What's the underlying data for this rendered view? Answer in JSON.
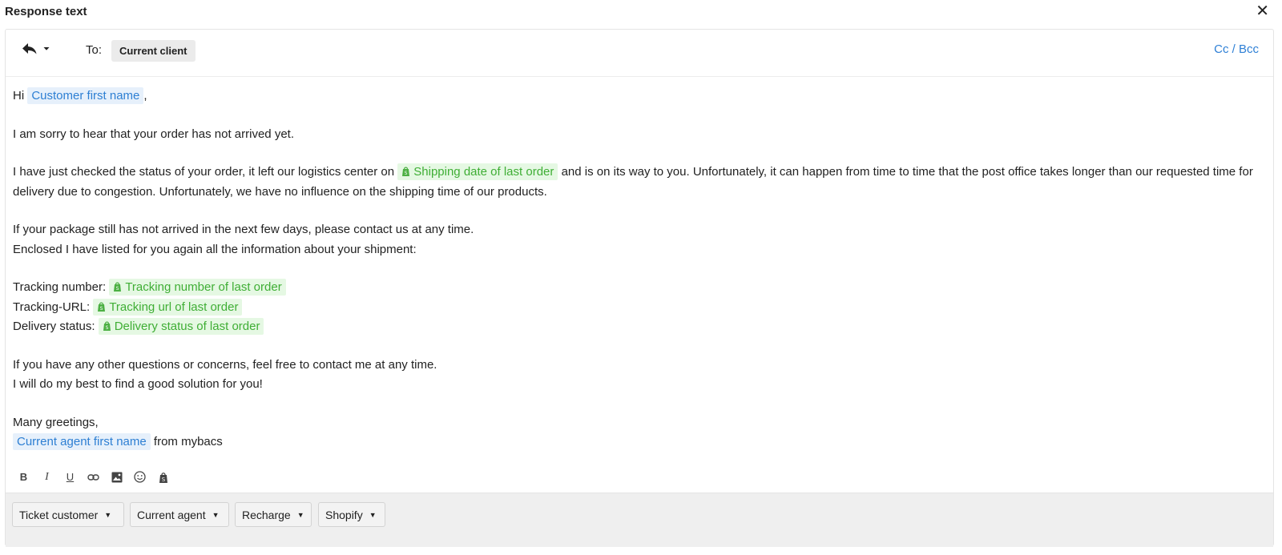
{
  "window": {
    "title": "Response text"
  },
  "header": {
    "to_label": "To:",
    "recipient": "Current client",
    "cc_bcc": "Cc / Bcc"
  },
  "message": {
    "greeting_prefix": "Hi",
    "var_customer_first_name": "Customer first name",
    "greeting_suffix": ",",
    "line1": "I am sorry to hear that your order has not arrived yet.",
    "line2_a": "I have just checked the status of your order, it left our logistics center on",
    "var_shipping_date": "Shipping date of last order",
    "line2_b": "and is on its way to you. Unfortunately, it can happen from time to time that the post office takes longer than our requested time for delivery due to congestion. Unfortunately, we have no influence on the shipping time of our products.",
    "line3": "If your package still has not arrived in the next few days, please contact us at any time.",
    "line4": "Enclosed I have listed for you again all the information about your shipment:",
    "tracking_number_label": "Tracking number:",
    "var_tracking_number": "Tracking number of last order",
    "tracking_url_label": "Tracking-URL:",
    "var_tracking_url": "Tracking url of last order",
    "delivery_status_label": "Delivery status:",
    "var_delivery_status": "Delivery status of last order",
    "line5": "If you have any other questions or concerns, feel free to contact me at any time.",
    "line6": "I will do my best to find a good solution for you!",
    "closing": "Many greetings,",
    "var_agent_first_name": "Current agent first name",
    "signature_suffix": "from mybacs"
  },
  "toolbar": {
    "icons": [
      "bold-icon",
      "italic-icon",
      "underline-icon",
      "link-icon",
      "image-icon",
      "emoji-icon",
      "shopify-icon"
    ]
  },
  "footer": {
    "dropdowns": [
      "Ticket customer",
      "Current agent",
      "Recharge",
      "Shopify"
    ]
  },
  "colors": {
    "variable_blue": "#2d7fd3",
    "variable_green": "#3fae35",
    "link_blue": "#2f80d6"
  }
}
